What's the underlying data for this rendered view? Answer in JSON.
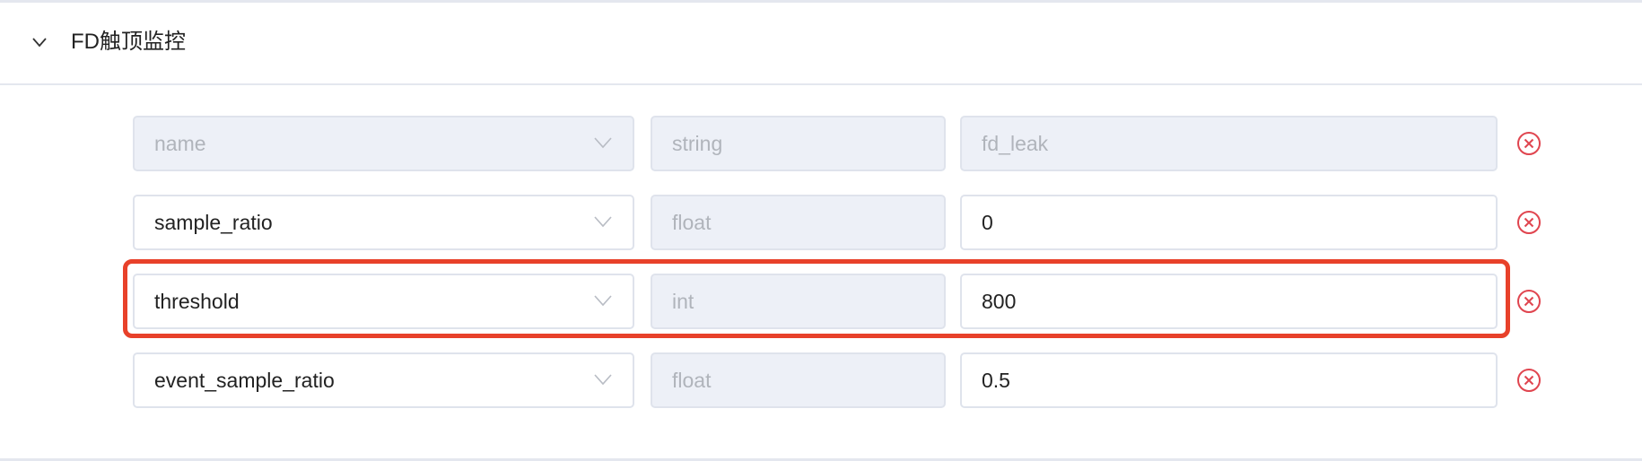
{
  "section": {
    "title": "FD触顶监控",
    "expanded": true
  },
  "rows": [
    {
      "key": "name",
      "type": "string",
      "value": "fd_leak",
      "disabled": true
    },
    {
      "key": "sample_ratio",
      "type": "float",
      "value": "0",
      "disabled": false
    },
    {
      "key": "threshold",
      "type": "int",
      "value": "800",
      "disabled": false,
      "highlighted": true
    },
    {
      "key": "event_sample_ratio",
      "type": "float",
      "value": "0.5",
      "disabled": false
    }
  ],
  "colors": {
    "highlight": "#e8412a",
    "delete": "#e0454f",
    "disabled_bg": "#edf0f7",
    "border": "#dfe3ec"
  },
  "icons": {
    "collapse": "chevron-down-icon",
    "dropdown": "chevron-down-icon",
    "delete": "circle-x-icon"
  }
}
